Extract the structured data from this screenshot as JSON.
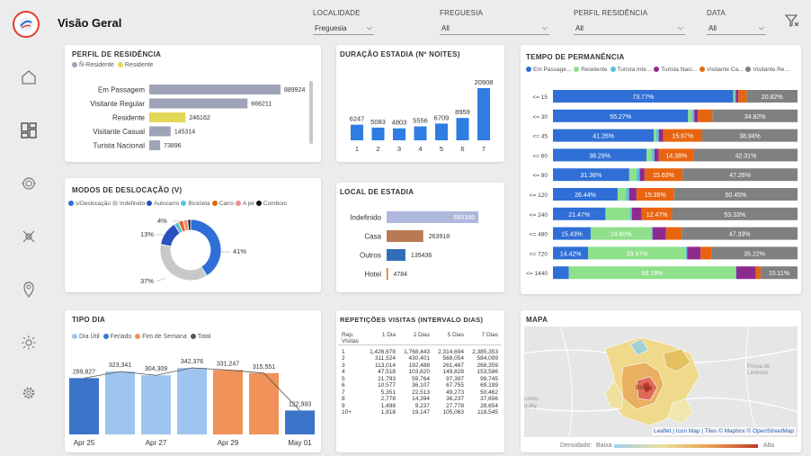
{
  "header": {
    "title": "Visão Geral"
  },
  "filters": [
    {
      "label": "LOCALIDADE",
      "value": "Freguesia"
    },
    {
      "label": "FREGUESIA",
      "value": "All"
    },
    {
      "label": "PERFIL RESIDÊNCIA",
      "value": "All"
    },
    {
      "label": "DATA",
      "value": "All"
    }
  ],
  "sidebar": {
    "items": [
      "home-icon",
      "dashboard-icon",
      "money-icon",
      "satellite-icon",
      "location-icon",
      "sun-icon",
      "gear-icon"
    ]
  },
  "perfil": {
    "title": "PERFIL DE RESIDÊNCIA",
    "legend": [
      {
        "label": "Ñ-Residente",
        "color": "#9ea3b8"
      },
      {
        "label": "Residente",
        "color": "#e3d85a"
      }
    ],
    "rows": [
      {
        "label": "Em Passagem",
        "value": 889924,
        "display": "889924",
        "color": "#9ea3b8"
      },
      {
        "label": "Visitante Regular",
        "value": 666211,
        "display": "666211",
        "color": "#9ea3b8"
      },
      {
        "label": "Residente",
        "value": 246162,
        "display": "246162",
        "color": "#e3d85a"
      },
      {
        "label": "Visitante Casual",
        "value": 145314,
        "display": "145314",
        "color": "#9ea3b8"
      },
      {
        "label": "Turista Nacional",
        "value": 73896,
        "display": "73896",
        "color": "#9ea3b8"
      }
    ]
  },
  "duracao": {
    "title": "DURAÇÃO ESTADIA (Nº NOITES)",
    "chart_data": {
      "type": "bar",
      "categories": [
        "1",
        "2",
        "3",
        "4",
        "5",
        "6",
        "7"
      ],
      "values": [
        6247,
        5083,
        4803,
        5556,
        6709,
        8959,
        20908
      ],
      "labels": [
        "6247",
        "5083",
        "4803",
        "5556",
        "6709",
        "8959",
        "20908"
      ]
    }
  },
  "tempo": {
    "title": "TEMPO DE PERMANÊNCIA",
    "legend": [
      {
        "label": "Em Passage...",
        "color": "#2f6fd6"
      },
      {
        "label": "Residente",
        "color": "#8ee08a"
      },
      {
        "label": "Turista Inte...",
        "color": "#5bc0de"
      },
      {
        "label": "Turista Naci...",
        "color": "#8e2a8e"
      },
      {
        "label": "Visitante Ca...",
        "color": "#e8650f"
      },
      {
        "label": "Visitante Re...",
        "color": "#808080"
      }
    ],
    "chart_data": {
      "type": "bar",
      "categories": [
        "<= 15",
        "<= 30",
        "<= 45",
        "<= 60",
        "<= 90",
        "<= 120",
        "<= 240",
        "<= 480",
        "<= 720",
        "<= 1440"
      ],
      "rows": [
        {
          "label": "<= 15",
          "segs": [
            73.77,
            0.5,
            0.5,
            1.0,
            3.4,
            20.82
          ],
          "texts": [
            "73.77%",
            "",
            "",
            "",
            "",
            "20.82%"
          ]
        },
        {
          "label": "<= 30",
          "segs": [
            55.27,
            1.5,
            1.0,
            1.5,
            5.9,
            34.82
          ],
          "texts": [
            "55.27%",
            "",
            "",
            "",
            "",
            "34.82%"
          ]
        },
        {
          "label": "<= 45",
          "segs": [
            41.26,
            1.0,
            1.0,
            1.8,
            15.97,
            38.94
          ],
          "texts": [
            "41.26%",
            "",
            "",
            "",
            "15.97%",
            "38.94%"
          ]
        },
        {
          "label": "<= 60",
          "segs": [
            38.29,
            2.0,
            1.2,
            1.8,
            14.38,
            42.31
          ],
          "texts": [
            "38.29%",
            "",
            "",
            "",
            "14.38%",
            "42.31%"
          ]
        },
        {
          "label": "<= 90",
          "segs": [
            31.36,
            3.0,
            1.3,
            2.0,
            15.63,
            47.26
          ],
          "texts": [
            "31.36%",
            "",
            "",
            "",
            "15.63%",
            "47.26%"
          ]
        },
        {
          "label": "<= 120",
          "segs": [
            26.44,
            3.5,
            1.2,
            3.0,
            15.35,
            50.45
          ],
          "texts": [
            "26.44%",
            "",
            "",
            "",
            "15.35%",
            "50.45%"
          ]
        },
        {
          "label": "<= 240",
          "segs": [
            21.47,
            10.0,
            0.8,
            4.0,
            12.47,
            51.26
          ],
          "texts": [
            "21.47%",
            "",
            "",
            "",
            "12.47%",
            "53.33%"
          ]
        },
        {
          "label": "<= 480",
          "segs": [
            15.43,
            24.8,
            0.5,
            5.5,
            6.44,
            47.33
          ],
          "texts": [
            "15.43%",
            "24.80%",
            "",
            "",
            "",
            "47.33%"
          ]
        },
        {
          "label": "<= 720",
          "segs": [
            14.42,
            39.97,
            0.5,
            5.5,
            4.39,
            35.22
          ],
          "texts": [
            "14.42%",
            "39.97%",
            "",
            "",
            "",
            "35.22%"
          ]
        },
        {
          "label": "<= 1440",
          "segs": [
            6.5,
            68.18,
            0.3,
            8.0,
            1.9,
            15.11
          ],
          "texts": [
            "",
            "68.18%",
            "",
            "",
            "",
            "15.11%"
          ]
        }
      ]
    }
  },
  "modos": {
    "title": "MODOS DE DESLOCAÇÃO (V)",
    "legend": [
      {
        "label": "s/Deslocação",
        "color": "#2f6fd6"
      },
      {
        "label": "Indefinido",
        "color": "#c8c8c8"
      },
      {
        "label": "Autocarro",
        "color": "#2a4fbf"
      },
      {
        "label": "Bicicleta",
        "color": "#5bc0de"
      },
      {
        "label": "Carro",
        "color": "#e8650f"
      },
      {
        "label": "A pé",
        "color": "#f08f8f"
      },
      {
        "label": "Comboio",
        "color": "#111111"
      }
    ],
    "chart_data": {
      "type": "pie",
      "labels": [
        "s/Deslocação",
        "Indefinido",
        "Autocarro",
        "Bicicleta",
        "Carro",
        "A pé",
        "Comboio"
      ],
      "values": [
        41,
        37,
        13,
        2.5,
        2.5,
        2.5,
        1.5
      ],
      "labels_shown": [
        "41%",
        "37%",
        "13%",
        "4%"
      ]
    }
  },
  "local": {
    "title": "LOCAL DE ESTADIA",
    "chart_data": {
      "type": "bar",
      "categories": [
        "Indefinido",
        "Casa",
        "Outros",
        "Hotel"
      ],
      "values": [
        660166,
        263918,
        135436,
        4784
      ],
      "labels": [
        "660166",
        "263918",
        "135436",
        "4784"
      ],
      "colors": [
        "#aeb7dc",
        "#b87a54",
        "#2f6fb8",
        "#e8650f"
      ]
    }
  },
  "tipodia": {
    "title": "TIPO DIA",
    "legend": [
      {
        "label": "Dia Útil",
        "color": "#9ec5ef"
      },
      {
        "label": "Feriado",
        "color": "#3b74c8"
      },
      {
        "label": "Fim de Semana",
        "color": "#f0925a"
      },
      {
        "label": "Total",
        "color": "#555555"
      }
    ],
    "chart_data": {
      "type": "bar",
      "categories": [
        "Apr 25",
        "Apr 26",
        "Apr 27",
        "Apr 28",
        "Apr 29",
        "Apr 30",
        "May 01"
      ],
      "values": [
        289827,
        323341,
        304309,
        342376,
        331247,
        315551,
        122993
      ],
      "labels": [
        "289,827",
        "323,341",
        "304,309",
        "342,376",
        "331,247",
        "315,551",
        "122,993"
      ],
      "colors": [
        "#3b74c8",
        "#9ec5ef",
        "#9ec5ef",
        "#9ec5ef",
        "#f0925a",
        "#f0925a",
        "#3b74c8"
      ],
      "ticks": [
        "Apr 25",
        "Apr 27",
        "Apr 29",
        "May 01"
      ]
    }
  },
  "repeticoes": {
    "title": "REPETIÇÕES VISITAS (INTERVALO DIAS)",
    "headers": [
      "Rep. Visitas",
      "1 Dia",
      "2 Dias",
      "5 Dias",
      "7 Dias"
    ],
    "rows": [
      [
        "1",
        "1,426,678",
        "1,768,443",
        "2,314,694",
        "2,385,353"
      ],
      [
        "2",
        "311,524",
        "430,401",
        "568,054",
        "584,099"
      ],
      [
        "3",
        "113,014",
        "192,488",
        "261,467",
        "268,359"
      ],
      [
        "4",
        "47,518",
        "103,620",
        "149,828",
        "153,586"
      ],
      [
        "5",
        "21,793",
        "59,764",
        "97,397",
        "99,745"
      ],
      [
        "6",
        "10,577",
        "36,107",
        "67,755",
        "69,199"
      ],
      [
        "7",
        "5,351",
        "22,513",
        "49,273",
        "50,462"
      ],
      [
        "8",
        "2,778",
        "14,394",
        "36,237",
        "37,656"
      ],
      [
        "9",
        "1,498",
        "9,237",
        "27,778",
        "28,654"
      ],
      [
        "10+",
        "1,818",
        "19,147",
        "105,063",
        "118,545"
      ]
    ]
  },
  "mapa": {
    "title": "MAPA",
    "place_braga": "Braga",
    "place_povoa": "Póvoa de Lanhoso",
    "place_barcelos": "rcelos",
    "place_aquilty": "quilty",
    "attribution": "Leaflet | Icon Map | Tiles © Mapbox © OpenStreetMap",
    "density_label": "Densidade:",
    "low": "Baixa",
    "high": "Alta"
  }
}
